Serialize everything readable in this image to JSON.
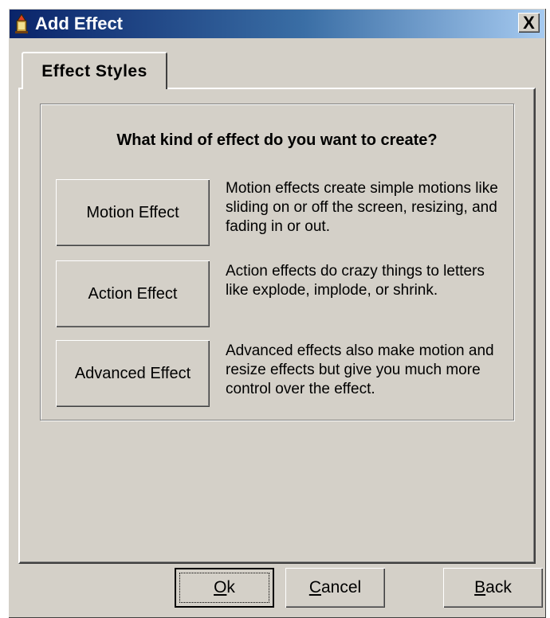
{
  "window": {
    "title": "Add Effect",
    "close_glyph": "X",
    "icon": "app-icon"
  },
  "tabs": [
    {
      "label": "Effect Styles",
      "selected": true
    }
  ],
  "content": {
    "question": "What kind of effect do you want to create?",
    "effects": [
      {
        "button_label": "Motion Effect",
        "description": "Motion effects create simple motions like sliding on or off the screen, resizing, and fading in or out."
      },
      {
        "button_label": "Action Effect",
        "description": "Action effects do crazy things to letters like explode, implode, or shrink."
      },
      {
        "button_label": "Advanced Effect",
        "description": "Advanced effects also make motion and resize effects but give you much more control over the effect."
      }
    ]
  },
  "footer": {
    "ok": {
      "mnemonic": "O",
      "rest": "k"
    },
    "cancel": {
      "mnemonic": "C",
      "rest": "ancel"
    },
    "back": {
      "mnemonic": "B",
      "rest": "ack"
    }
  },
  "colors": {
    "face": "#d4d0c8",
    "title_start": "#0a246a",
    "title_end": "#a6caf0",
    "title_text": "#ffffff"
  }
}
